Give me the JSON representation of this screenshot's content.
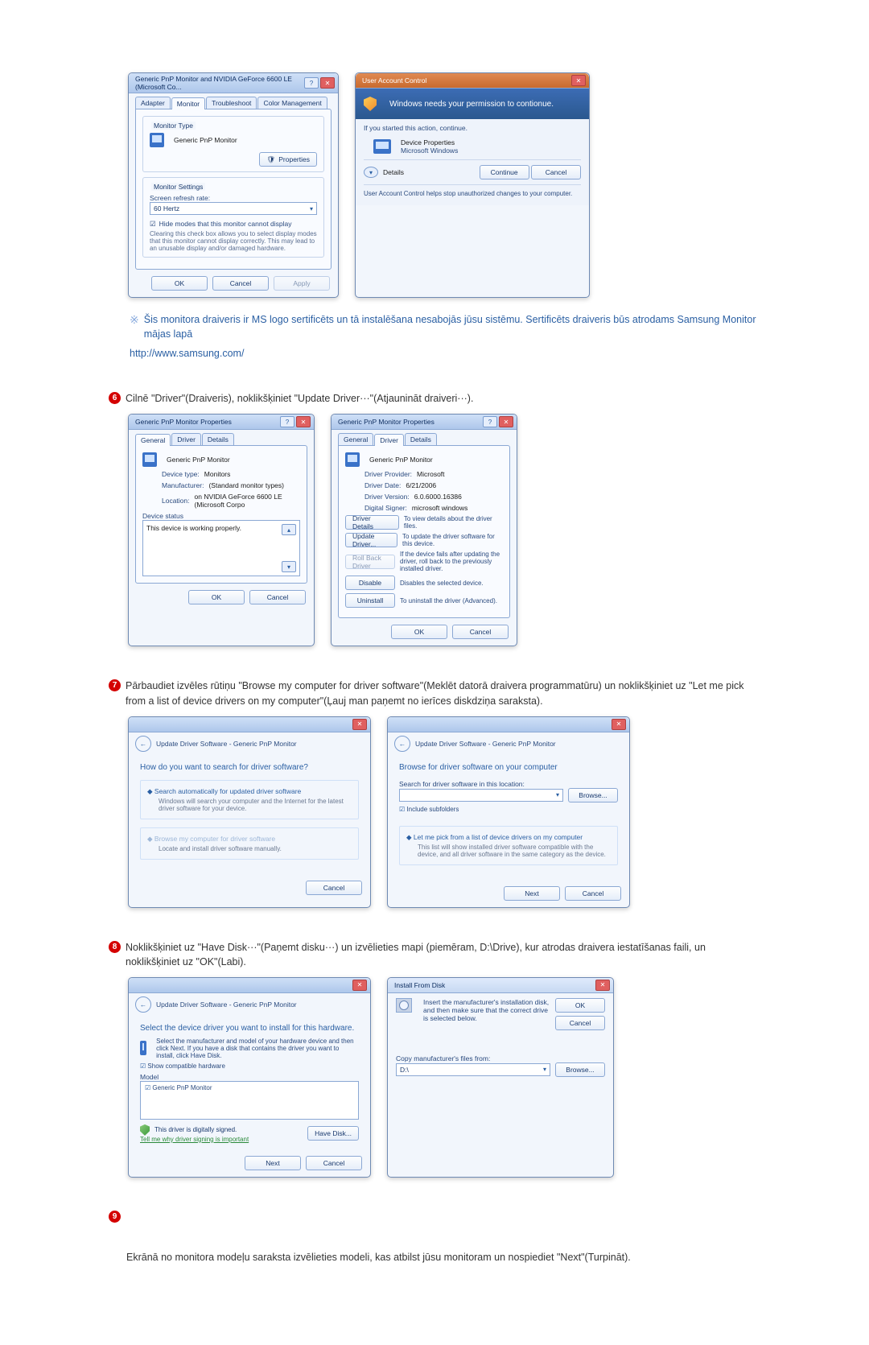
{
  "step6_label": "6",
  "step7_label": "7",
  "step8_label": "8",
  "step9_label": "9",
  "note_text": "Šis monitora draiveris ir MS logo sertificēts un tā instalēšana nesabojās jūsu sistēmu. Sertificēts draiveris būs atrodams Samsung Monitor mājas lapā",
  "samsung_link": "http://www.samsung.com/",
  "step6_text": "Cilnē \"Driver\"(Draiveris), noklikšķiniet \"Update Driver···\"(Atjaunināt draiveri···).",
  "step7_text": "Pārbaudiet izvēles rūtiņu \"Browse my computer for driver software\"(Meklēt datorā draivera programmatūru) un noklikšķiniet uz \"Let me pick from a list of device drivers on my computer\"(Ļauj man paņemt no ierīces diskdziņa saraksta).",
  "step8_text": "Noklikšķiniet uz \"Have Disk···\"(Paņemt disku···) un izvēlieties mapi (piemēram, D:\\Drive), kur atrodas draivera iestatīšanas faili, un noklikšķiniet uz \"OK\"(Labi).",
  "step9_text": "Ekrānā no monitora modeļu saraksta izvēlieties modeli, kas atbilst jūsu monitoram un nospiediet \"Next\"(Turpināt).",
  "monDlg": {
    "title": "Generic PnP Monitor and NVIDIA GeForce 6600 LE (Microsoft Co...",
    "tabs": [
      "Adapter",
      "Monitor",
      "Troubleshoot",
      "Color Management"
    ],
    "monitorTypeLabel": "Monitor Type",
    "monitorType": "Generic PnP Monitor",
    "propertiesBtn": "Properties",
    "settingsLabel": "Monitor Settings",
    "refreshLabel": "Screen refresh rate:",
    "refreshValue": "60 Hertz",
    "hideModes": "Hide modes that this monitor cannot display",
    "hideHelp": "Clearing this check box allows you to select display modes that this monitor cannot display correctly. This may lead to an unusable display and/or damaged hardware.",
    "ok": "OK",
    "cancel": "Cancel",
    "apply": "Apply"
  },
  "uac": {
    "title": "User Account Control",
    "hero": "Windows needs your permission to contionue.",
    "ifStarted": "If you started this action, continue.",
    "progName": "Device Properties",
    "publisher": "Microsoft Windows",
    "details": "Details",
    "continue": "Continue",
    "cancel": "Cancel",
    "footer": "User Account Control helps stop unauthorized changes to your computer."
  },
  "propGen": {
    "title": "Generic PnP Monitor Properties",
    "tabs": [
      "General",
      "Driver",
      "Details"
    ],
    "device": "Generic PnP Monitor",
    "deviceTypeLbl": "Device type:",
    "deviceType": "Monitors",
    "manufacturerLbl": "Manufacturer:",
    "manufacturer": "(Standard monitor types)",
    "locationLbl": "Location:",
    "location": "on NVIDIA GeForce 6600 LE (Microsoft Corpo",
    "statusLbl": "Device status",
    "status": "This device is working properly.",
    "ok": "OK",
    "cancel": "Cancel"
  },
  "propDrv": {
    "title": "Generic PnP Monitor Properties",
    "device": "Generic PnP Monitor",
    "providerLbl": "Driver Provider:",
    "provider": "Microsoft",
    "dateLbl": "Driver Date:",
    "date": "6/21/2006",
    "versionLbl": "Driver Version:",
    "version": "6.0.6000.16386",
    "signerLbl": "Digital Signer:",
    "signer": "microsoft windows",
    "btnDetails": "Driver Details",
    "txtDetails": "To view details about the driver files.",
    "btnUpdate": "Update Driver...",
    "txtUpdate": "To update the driver software for this device.",
    "btnRollback": "Roll Back Driver",
    "txtRollback": "If the device fails after updating the driver, roll back to the previously installed driver.",
    "btnDisable": "Disable",
    "txtDisable": "Disables the selected device.",
    "btnUninstall": "Uninstall",
    "txtUninstall": "To uninstall the driver (Advanced).",
    "ok": "OK",
    "cancel": "Cancel"
  },
  "wiz1": {
    "crumb": "Update Driver Software - Generic PnP Monitor",
    "heading": "How do you want to search for driver software?",
    "opt1": "Search automatically for updated driver software",
    "opt1sub": "Windows will search your computer and the Internet for the latest driver software for your device.",
    "opt2": "Browse my computer for driver software",
    "opt2sub": "Locate and install driver software manually.",
    "cancel": "Cancel"
  },
  "wiz2": {
    "crumb": "Update Driver Software - Generic PnP Monitor",
    "heading": "Browse for driver software on your computer",
    "searchLbl": "Search for driver software in this location:",
    "browse": "Browse...",
    "include": "Include subfolders",
    "opt": "Let me pick from a list of device drivers on my computer",
    "optsub": "This list will show installed driver software compatible with the device, and all driver software in the same category as the device.",
    "next": "Next",
    "cancel": "Cancel"
  },
  "wiz3": {
    "crumb": "Update Driver Software - Generic PnP Monitor",
    "heading": "Select the device driver you want to install for this hardware.",
    "sub": "Select the manufacturer and model of your hardware device and then click Next. If you have a disk that contains the driver you want to install, click Have Disk.",
    "showCompat": "Show compatible hardware",
    "modelHdr": "Model",
    "model": "Generic PnP Monitor",
    "signed": "This driver is digitally signed.",
    "tell": "Tell me why driver signing is important",
    "haveDisk": "Have Disk...",
    "next": "Next",
    "cancel": "Cancel"
  },
  "disk": {
    "title": "Install From Disk",
    "msg": "Insert the manufacturer's installation disk, and then make sure that the correct drive is selected below.",
    "ok": "OK",
    "cancel": "Cancel",
    "copyLbl": "Copy manufacturer's files from:",
    "path": "D:\\",
    "browse": "Browse..."
  }
}
